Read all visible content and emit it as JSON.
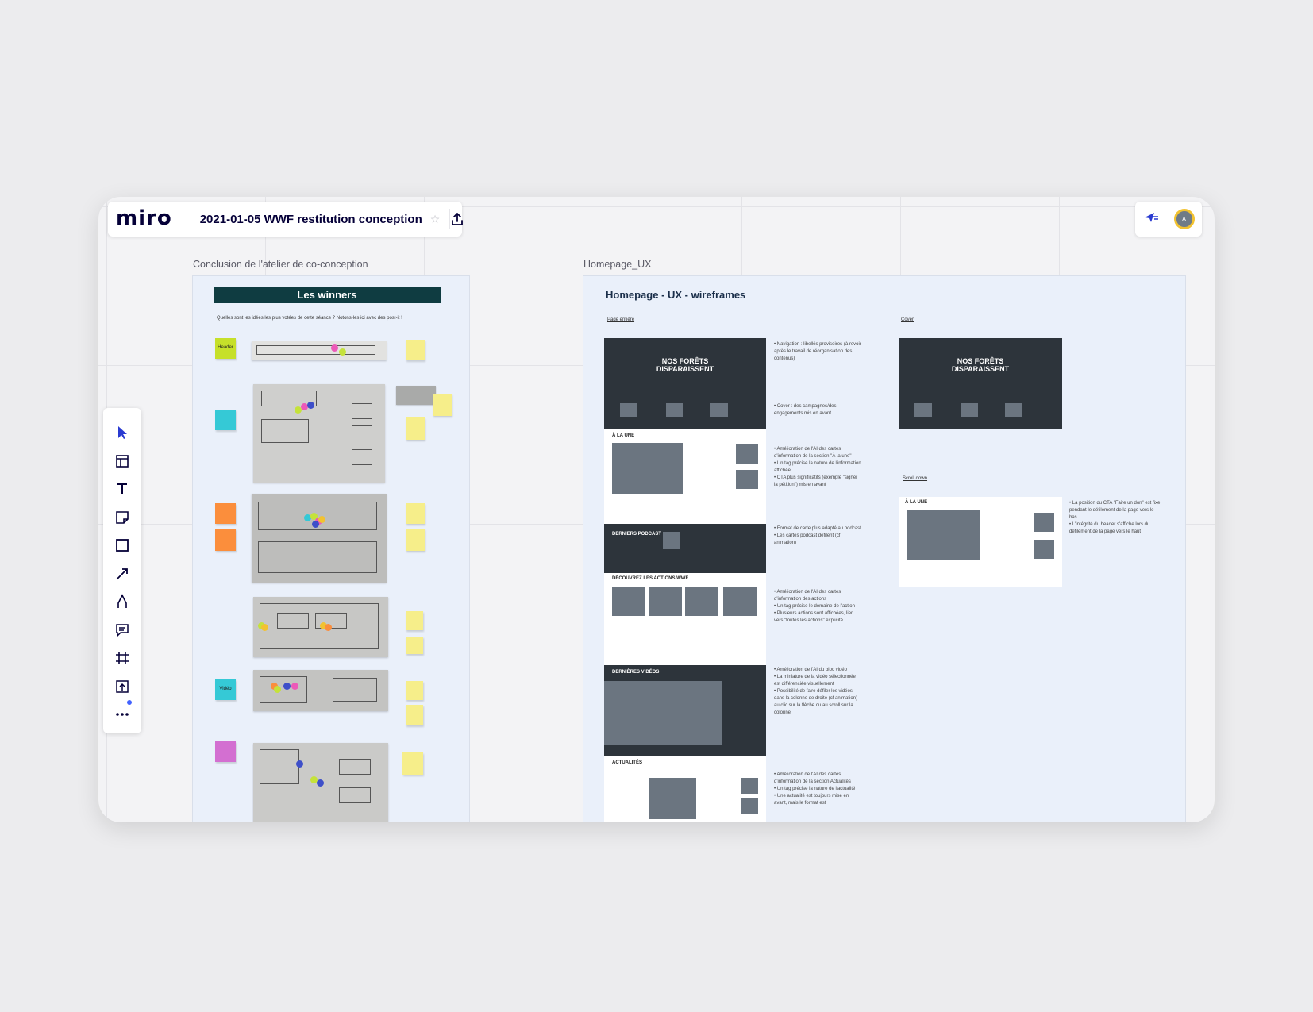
{
  "app": {
    "logo": "miro",
    "board_title": "2021-01-05 WWF restitution conception",
    "avatar_initial": "A",
    "colors": {
      "accent": "#4262ff",
      "frame_bg": "#eaf0fa",
      "banner": "#0f3c41",
      "avatar_ring": "#f2c230"
    }
  },
  "toolbar": {
    "tools": [
      "select-icon",
      "templates-icon",
      "text-icon",
      "sticky-note-icon",
      "shape-icon",
      "connection-line-icon",
      "pen-icon",
      "comment-icon",
      "frame-icon",
      "upload-icon",
      "more-icon"
    ]
  },
  "frames": {
    "left_label": "Conclusion de l'atelier de co-conception",
    "right_label": "Homepage_UX"
  },
  "winners": {
    "title": "Les winners",
    "question": "Quelles sont les idées les plus votées de cette séance ? Notons-les ici avec des post-it !",
    "stickies": [
      "Header",
      "Vidéo"
    ]
  },
  "ux": {
    "title": "Homepage - UX - wireframes",
    "link_full_page": "Page entière",
    "link_cover": "Cover",
    "link_scroll": "Scroll down",
    "hero_title_1": "NOS FORÊTS",
    "hero_title_2": "DISPARAISSENT",
    "sections": {
      "a_la_une": "À LA UNE",
      "podcast": "DERNIERS PODCAST",
      "actions": "DÉCOUVREZ LES ACTIONS WWF",
      "videos": "DERNIÈRES VIDÉOS",
      "actus": "ACTUALITÉS"
    },
    "notes": {
      "nav": [
        "Navigation : libellés provisoires (à revoir après le travail de réorganisation des contenus)"
      ],
      "cover": [
        "Cover : des campagnes/des engagements mis en avant"
      ],
      "une": [
        "Amélioration de l'AI des cartes d'information de la section \"À la une\"",
        "Un tag précise la nature de l'information affichée",
        "CTA plus significatifs (exemple \"signer la pétition\") mis en avant"
      ],
      "podcast": [
        "Format de carte plus adapté au podcast",
        "Les cartes podcast défilent (cf animation)"
      ],
      "actions": [
        "Amélioration de l'AI des cartes d'information des actions",
        "Un tag précise le domaine de l'action",
        "Plusieurs actions sont affichées, lien vers \"toutes les actions\" explicité"
      ],
      "videos": [
        "Amélioration de l'AI du bloc vidéo",
        "La miniature de la vidéo sélectionnée est différenciée visuellement",
        "Possibilité de faire défiler les vidéos dans la colonne de droite (cf animation) au clic sur la flèche ou au scroll sur la colonne"
      ],
      "actus": [
        "Amélioration de l'AI des cartes d'information de la section Actualités",
        "Un tag précise la nature de l'actualité",
        "Une actualité est toujours mise en avant, mais le format est"
      ],
      "scroll": [
        "La position du CTA \"Faire un don\" est fixe pendant le défilement de la page vers le bas",
        "L'intégrité du header s'affiche lors du défilement de la page vers le haut"
      ]
    }
  }
}
